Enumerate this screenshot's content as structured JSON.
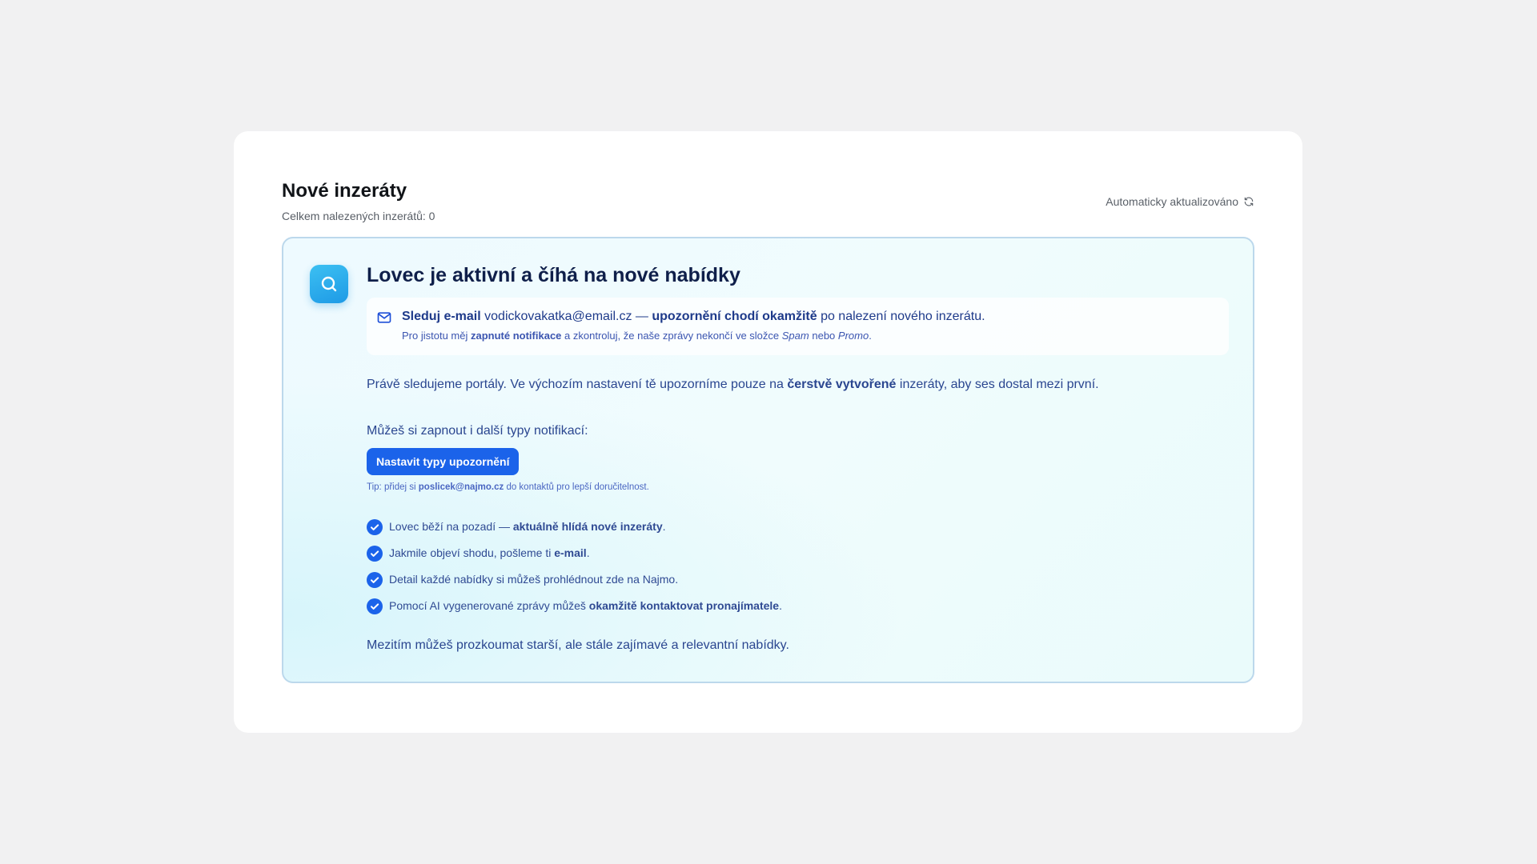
{
  "header": {
    "title": "Nové inzeráty",
    "subtitle": "Celkem nalezených inzerátů: 0",
    "auto_update": "Automaticky aktualizováno",
    "auto_update_icon": "refresh-icon"
  },
  "panel": {
    "icon": "search-icon",
    "title": "Lovec je aktivní a číhá na nové nabídky",
    "email_box": {
      "icon": "mail-icon",
      "follow_label": "Sleduj e-mail",
      "email": "vodickovakatka@email.cz",
      "dash": "—",
      "notify_strong": "upozornění chodí okamžitě",
      "notify_rest": "po nalezení nového inzerátu.",
      "hint_pre": "Pro jistotu měj",
      "hint_strong": "zapnuté notifikace",
      "hint_mid": "a zkontroluj, že naše zprávy nekončí ve složce",
      "hint_spam": "Spam",
      "hint_or": "nebo",
      "hint_promo": "Promo",
      "hint_end": "."
    },
    "watching": {
      "pre": "Právě sledujeme portály. Ve výchozím nastavení tě upozorníme pouze na",
      "strong": "čerstvě vytvořené",
      "post": "inzeráty, aby ses dostal mezi první."
    },
    "types_label": "Můžeš si zapnout i další typy notifikací:",
    "types_button": "Nastavit typy upozornění",
    "tip": {
      "pre": "Tip: přidej si",
      "email": "poslicek@najmo.cz",
      "post": "do kontaktů pro lepší doručitelnost."
    },
    "checks": [
      {
        "pre": "Lovec běží na pozadí —",
        "strong": "aktuálně hlídá nové inzeráty",
        "post": "."
      },
      {
        "pre": "Jakmile objeví shodu, pošleme ti",
        "strong": "e-mail",
        "post": "."
      },
      {
        "pre": "Detail každé nabídky si můžeš prohlédnout zde na Najmo.",
        "strong": "",
        "post": ""
      },
      {
        "pre": "Pomocí AI vygenerované zprávy můžeš",
        "strong": "okamžitě kontaktovat pronajímatele",
        "post": "."
      }
    ],
    "footer": "Mezitím můžeš prozkoumat starší, ale stále zajímavé a relevantní nabídky."
  },
  "colors": {
    "accent": "#1b63ea",
    "text_dark": "#0f1f4a",
    "text_blue": "#2a4690",
    "panel_border": "#bcd8ec"
  }
}
